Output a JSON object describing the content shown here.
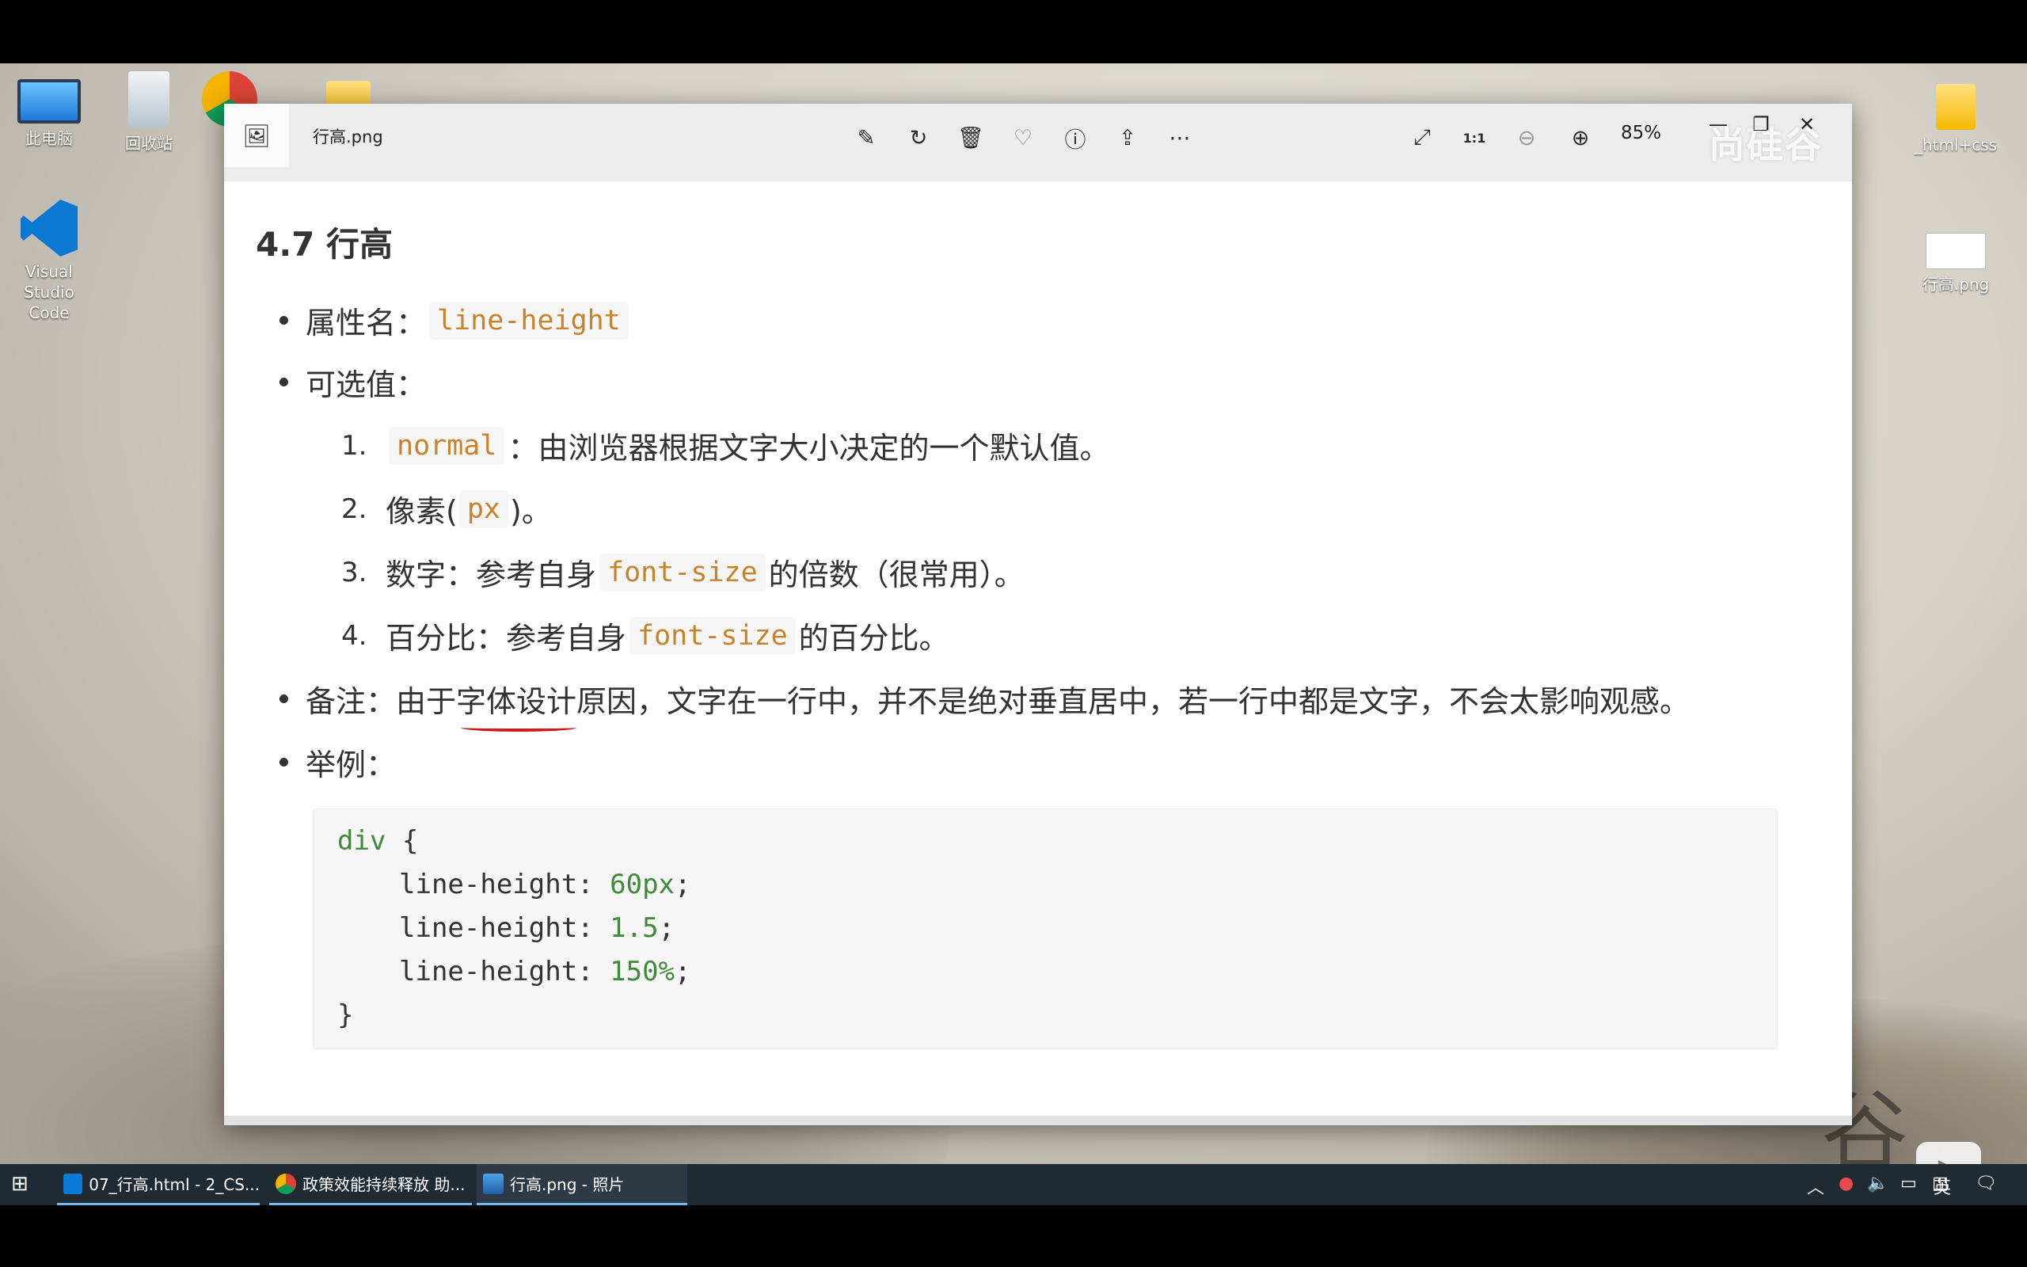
{
  "desktop": {
    "icons": [
      {
        "label": "此电脑"
      },
      {
        "label": "回收站"
      },
      {
        "label": "Visual Studio Code"
      },
      {
        "label": "_html+css"
      },
      {
        "label": "行高.png"
      }
    ]
  },
  "window": {
    "title": "行高.png",
    "zoom": "85%",
    "watermark": "尚硅谷",
    "toolbar_icons": [
      "edit-icon",
      "rotate-icon",
      "delete-icon",
      "favorite-icon",
      "info-icon",
      "share-icon",
      "more-icon"
    ],
    "view_icons": [
      "fullscreen-icon",
      "actual-size-icon",
      "zoom-out-icon",
      "zoom-in-icon"
    ]
  },
  "doc": {
    "heading": "4.7 行高",
    "prop_label": "属性名：",
    "prop_value": "line-height",
    "options_label": "可选值：",
    "options": [
      {
        "num": "1.",
        "code": "normal",
        "text": "：由浏览器根据文字大小决定的一个默认值。"
      },
      {
        "num": "2.",
        "pre": "像素(",
        "code": "px",
        "post": ")。"
      },
      {
        "num": "3.",
        "pre": "数字：参考自身",
        "code": "font-size",
        "post": "的倍数（很常用）。"
      },
      {
        "num": "4.",
        "pre": "百分比：参考自身",
        "code": "font-size",
        "post": "的百分比。"
      }
    ],
    "note_pre": "备注：由于",
    "note_mark": "字体设计",
    "note_post": "原因，文字在一行中，并不是绝对垂直居中，若一行中都是文字，不会太影响观感。",
    "example_label": "举例：",
    "code": {
      "selector": "div",
      "open": " {",
      "lines": [
        {
          "prop": "line-height",
          "value": "60px"
        },
        {
          "prop": "line-height",
          "value": "1.5"
        },
        {
          "prop": "line-height",
          "value": "150%"
        }
      ],
      "close": "}"
    }
  },
  "taskbar": {
    "items": [
      {
        "label": "07_行高.html - 2_CS..."
      },
      {
        "label": "政策效能持续释放 助..."
      },
      {
        "label": "行高.png - 照片"
      }
    ],
    "ime": "英"
  }
}
